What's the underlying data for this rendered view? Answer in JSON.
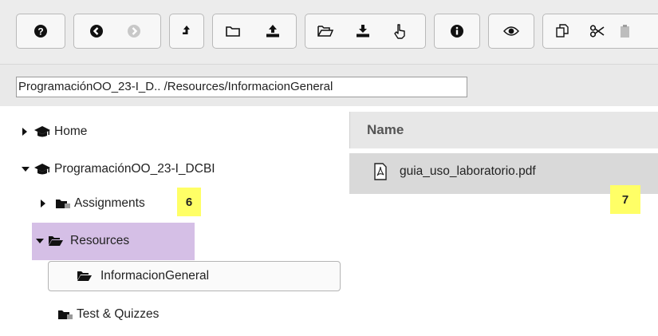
{
  "toolbar": {
    "icons": [
      "help-icon",
      "back-icon",
      "forward-icon",
      "parent-folder-icon",
      "new-folder-icon",
      "upload-icon",
      "open-folder-icon",
      "download-icon",
      "select-icon",
      "info-icon",
      "preview-icon",
      "copy-icon",
      "cut-icon",
      "paste-icon"
    ]
  },
  "address": {
    "value": "ProgramaciónOO_23-I_D.. /Resources/InformacionGeneral"
  },
  "tree": {
    "home": "Home",
    "site": "ProgramaciónOO_23-I_DCBI",
    "assignments": "Assignments",
    "resources": "Resources",
    "informacion": "InformacionGeneral",
    "tests": "Test & Quizzes"
  },
  "files": {
    "header_name": "Name",
    "items": [
      {
        "name": "guia_uso_laboratorio.pdf",
        "icon": "pdf-file-icon"
      }
    ]
  },
  "annotations": {
    "badge_6": "6",
    "badge_7": "7"
  },
  "colors": {
    "highlight": "#d5bfe6",
    "badge": "#ffff66",
    "selected_row": "#d9d9d9",
    "toolbar_bg": "#ececec"
  }
}
